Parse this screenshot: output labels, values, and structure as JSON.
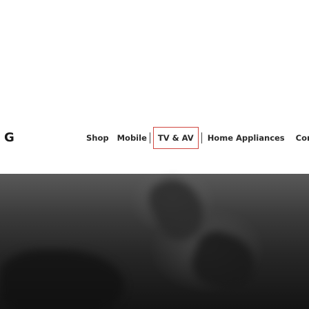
{
  "header": {
    "logo_text": "G",
    "nav": [
      {
        "label": "Shop"
      },
      {
        "label": "Mobile"
      },
      {
        "label": "TV & AV"
      },
      {
        "label": "Home Appliances"
      },
      {
        "label": "Computir"
      }
    ]
  },
  "colors": {
    "active_border": "#d0463f",
    "hero_dark": "#141414"
  }
}
